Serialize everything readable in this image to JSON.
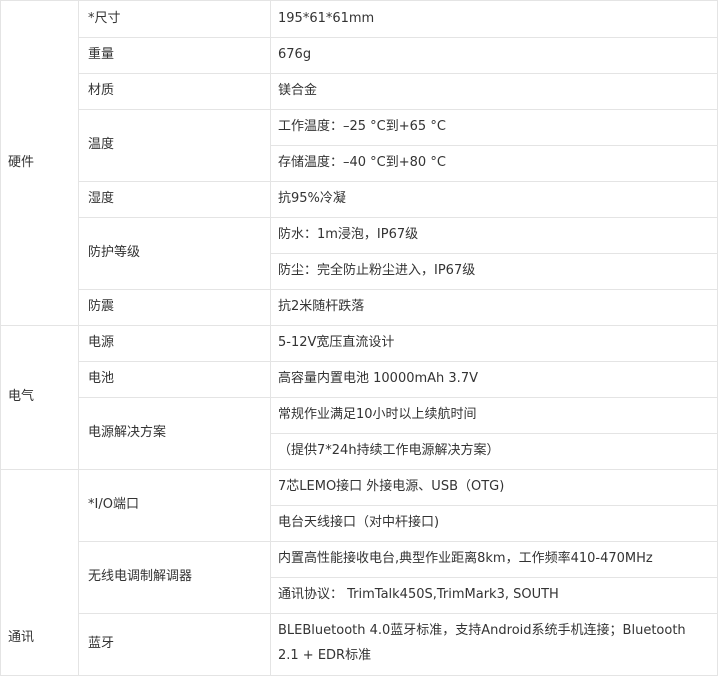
{
  "sections": [
    {
      "category": "硬件",
      "rows": [
        {
          "label": "*尺寸",
          "values": [
            "195*61*61mm"
          ]
        },
        {
          "label": "重量",
          "values": [
            "676g"
          ]
        },
        {
          "label": "材质",
          "values": [
            "镁合金"
          ]
        },
        {
          "label": "温度",
          "values": [
            "工作温度：–25 °C到+65 °C",
            "存储温度：–40 °C到+80 °C"
          ]
        },
        {
          "label": "湿度",
          "values": [
            "抗95%冷凝"
          ]
        },
        {
          "label": "防护等级",
          "values": [
            "防水：1m浸泡，IP67级",
            "防尘：完全防止粉尘进入，IP67级"
          ]
        },
        {
          "label": "防震",
          "values": [
            "抗2米随杆跌落"
          ]
        }
      ]
    },
    {
      "category": "电气",
      "rows": [
        {
          "label": "电源",
          "values": [
            "5-12V宽压直流设计"
          ]
        },
        {
          "label": "电池",
          "values": [
            "高容量内置电池 10000mAh 3.7V"
          ]
        },
        {
          "label": "电源解决方案",
          "values": [
            "常规作业满足10小时以上续航时间",
            "（提供7*24h持续工作电源解决方案）"
          ]
        }
      ]
    },
    {
      "category": "通讯",
      "rows": [
        {
          "label": "*I/O端口",
          "values": [
            "7芯LEMO接口  外接电源、USB（OTG)",
            "电台天线接口（对中杆接口)"
          ]
        },
        {
          "label": "无线电调制解调器",
          "values": [
            "内置高性能接收电台,典型作业距离8km，工作频率410-470MHz",
            "通讯协议：  TrimTalk450S,TrimMark3, SOUTH"
          ]
        },
        {
          "label": "蓝牙",
          "values": [
            "BLEBluetooth 4.0蓝牙标准，支持Android系统手机连接；Bluetooth",
            " 2.1 + EDR标准"
          ]
        }
      ]
    }
  ]
}
